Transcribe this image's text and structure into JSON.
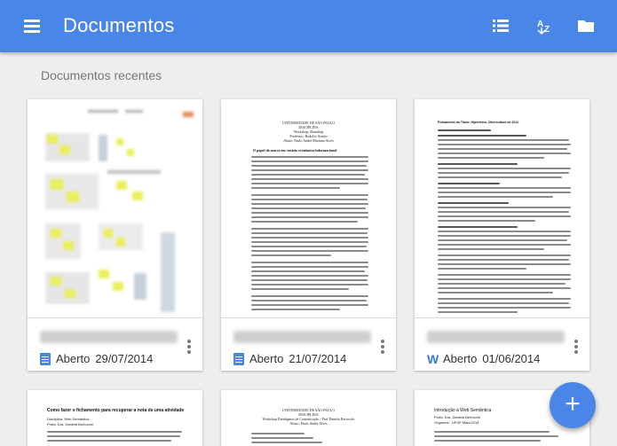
{
  "app": {
    "title": "Documentos"
  },
  "section": {
    "title": "Documentos recentes"
  },
  "actions": {
    "list_view_icon": "list-view-icon",
    "sort_icon": "sort-az-icon",
    "folder_icon": "folder-icon",
    "menu_icon": "hamburger-menu-icon"
  },
  "colors": {
    "app_bar": "#4a86e8",
    "accent": "#4a86e8",
    "background": "#eeeeee"
  },
  "documents": [
    {
      "type": "docs",
      "status": "Aberto",
      "date": "29/07/2014"
    },
    {
      "type": "docs",
      "status": "Aberto",
      "date": "21/07/2014"
    },
    {
      "type": "word",
      "status": "Aberto",
      "date": "01/06/2014"
    }
  ],
  "previews": {
    "doc2": {
      "header": [
        "UNIVERSIDADE DE SÃO PAULO",
        "DISCIPLINA",
        "Workshop, Branding",
        "Professor: Rodolfo Araújo",
        "Aluno: Paulo André Mariano Alves"
      ],
      "heading": "O papel da marca em cenário econômico/informacional"
    },
    "doc3": {
      "title": "Fichamento do Título: Hipertexto, Cibercultura de 2011"
    },
    "doc4": {
      "lines": [
        "Como fazer o fichamento para recuperar a nota de uma atividade",
        "Disciplina: Web Semântica",
        "Profa. Dra. Daniela Bertocchi"
      ]
    },
    "doc5": {
      "lines": [
        "UNIVERSIDADE DE SÃO PAULO",
        "DISCIPLINA",
        "Workshop Paradigmas de Comunicação - Prof Daniela Bertocchi",
        "Aluno: Paulo André Alves"
      ]
    },
    "doc6": {
      "lines": [
        "Introdução à Web Semântica",
        "Profa. Dra. Daniela Bertocchi",
        "Orgames - UFSP Maio/2014"
      ]
    }
  },
  "fab": {
    "label": "+"
  }
}
